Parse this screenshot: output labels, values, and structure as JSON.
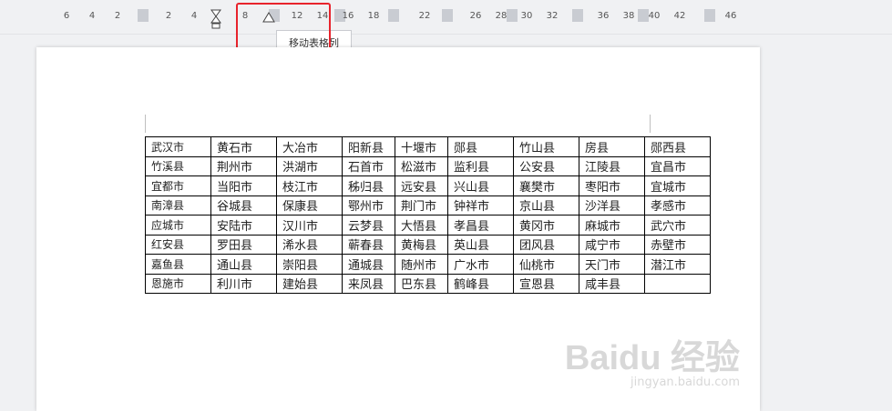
{
  "ruler": {
    "numbers": [
      "6",
      "4",
      "2",
      "2",
      "4",
      "8",
      "12",
      "14",
      "16",
      "18",
      "22",
      "26",
      "28",
      "30",
      "32",
      "36",
      "38",
      "40",
      "42",
      "46"
    ]
  },
  "tooltip": {
    "text": "移动表格列"
  },
  "table": {
    "rows": [
      [
        "武汉市",
        "黄石市",
        "大冶市",
        "阳新县",
        "十堰市",
        "郧县",
        "竹山县",
        "房县",
        "郧西县"
      ],
      [
        "竹溪县",
        "荆州市",
        "洪湖市",
        "石首市",
        "松滋市",
        "监利县",
        "公安县",
        "江陵县",
        "宜昌市"
      ],
      [
        "宜都市",
        "当阳市",
        "枝江市",
        "秭归县",
        "远安县",
        "兴山县",
        "襄樊市",
        "枣阳市",
        "宜城市"
      ],
      [
        "南漳县",
        "谷城县",
        "保康县",
        "鄂州市",
        "荆门市",
        "钟祥市",
        "京山县",
        "沙洋县",
        "孝感市"
      ],
      [
        "应城市",
        "安陆市",
        "汉川市",
        "云梦县",
        "大悟县",
        "孝昌县",
        "黄冈市",
        "麻城市",
        "武穴市"
      ],
      [
        "红安县",
        "罗田县",
        "浠水县",
        "蕲春县",
        "黄梅县",
        "英山县",
        "团风县",
        "咸宁市",
        "赤壁市"
      ],
      [
        "嘉鱼县",
        "通山县",
        "崇阳县",
        "通城县",
        "随州市",
        "广水市",
        "仙桃市",
        "天门市",
        "潜江市"
      ],
      [
        "恩施市",
        "利川市",
        "建始县",
        "来凤县",
        "巴东县",
        "鹤峰县",
        "宣恩县",
        "咸丰县",
        ""
      ]
    ]
  },
  "watermark": {
    "logo": "Baidu 经验",
    "url": "jingyan.baidu.com"
  },
  "colors": {
    "highlight": "#e8232c",
    "page": "#ffffff",
    "background": "#f0f1f3"
  }
}
